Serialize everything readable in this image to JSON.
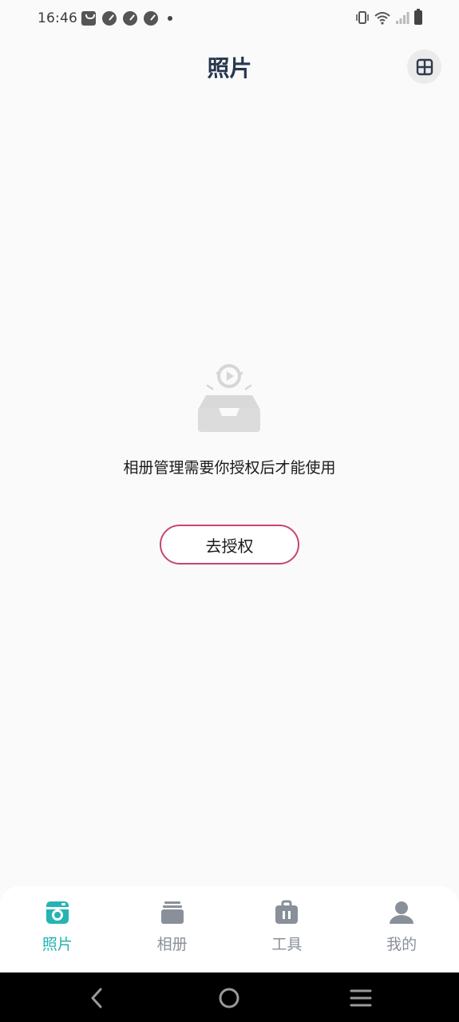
{
  "status_bar": {
    "time": "16:46",
    "icons_left": [
      "bag-icon",
      "gauge-icon",
      "gauge-icon",
      "gauge-icon",
      "dot-icon"
    ],
    "icons_right": [
      "vibrate-icon",
      "wifi-icon",
      "signal-icon",
      "battery-icon"
    ]
  },
  "header": {
    "title": "照片",
    "layout_icon": "grid-layout-icon"
  },
  "empty_state": {
    "illustration_icon": "empty-tray-icon",
    "message": "相册管理需要你授权后才能使用",
    "button_label": "去授权"
  },
  "tabs": [
    {
      "label": "照片",
      "icon": "camera-icon",
      "active": true
    },
    {
      "label": "相册",
      "icon": "album-icon",
      "active": false
    },
    {
      "label": "工具",
      "icon": "toolbox-icon",
      "active": false
    },
    {
      "label": "我的",
      "icon": "profile-icon",
      "active": false
    }
  ],
  "colors": {
    "accent": "#26b3b3",
    "button_border": "#c9456c",
    "title": "#27374d",
    "inactive_tab": "#8a9099",
    "background": "#fafafa"
  },
  "nav_bar": {
    "buttons": [
      "back-icon",
      "home-icon",
      "menu-icon"
    ]
  }
}
